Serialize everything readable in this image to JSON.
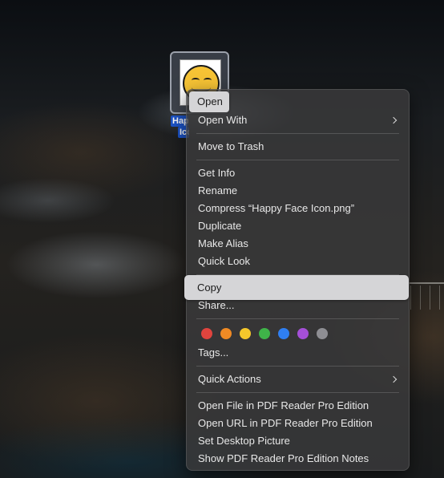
{
  "file": {
    "label_line1": "Happy Face",
    "label_line2": "Icon.png"
  },
  "context_menu": {
    "open": "Open",
    "open_with": "Open With",
    "move_to_trash": "Move to Trash",
    "get_info": "Get Info",
    "rename": "Rename",
    "compress": "Compress “Happy Face Icon.png”",
    "duplicate": "Duplicate",
    "make_alias": "Make Alias",
    "quick_look": "Quick Look",
    "copy": "Copy",
    "share": "Share...",
    "tags": "Tags...",
    "quick_actions": "Quick Actions",
    "open_file_pdf": "Open File in PDF Reader Pro Edition",
    "open_url_pdf": "Open URL in PDF Reader Pro Edition",
    "set_desktop_picture": "Set Desktop Picture",
    "show_pdf_notes": "Show PDF Reader Pro Edition Notes"
  },
  "tag_colors": [
    {
      "name": "red-tag",
      "color": "#e0443e"
    },
    {
      "name": "orange-tag",
      "color": "#f08a24"
    },
    {
      "name": "yellow-tag",
      "color": "#f4c72b"
    },
    {
      "name": "green-tag",
      "color": "#3fb449"
    },
    {
      "name": "blue-tag",
      "color": "#2f7ff2"
    },
    {
      "name": "purple-tag",
      "color": "#a54fd8"
    },
    {
      "name": "gray-tag",
      "color": "#8e8e93"
    }
  ]
}
